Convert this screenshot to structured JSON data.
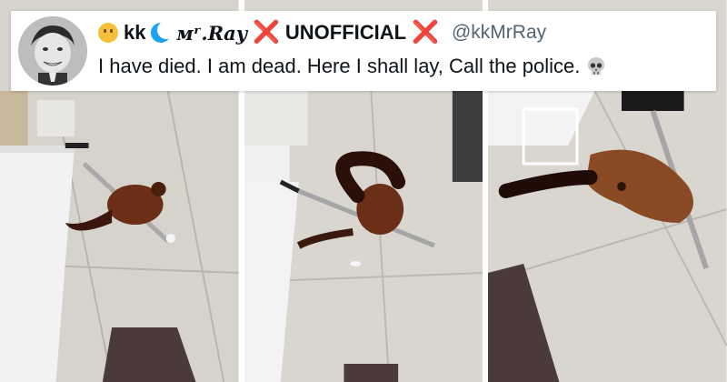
{
  "tweet": {
    "display_name_prefix": "kk",
    "display_name_mr": "ᴍʳ.𝑹𝒂𝒚",
    "display_name_suffix": "UNOFFICIAL",
    "x_mark": "❌",
    "handle": "@kkMrRay",
    "text": "I have died. I am dead. Here I shall lay, Call the police.",
    "icons": [
      "thinking-face-emoji",
      "moon-icon",
      "cross-mark-emoji",
      "skull-emoji"
    ]
  },
  "frames": [
    {
      "subject": "squirrel-clinging-to-mop"
    },
    {
      "subject": "squirrel-curled-on-mop"
    },
    {
      "subject": "squirrel-spread-on-mop"
    }
  ],
  "colors": {
    "floor": "#d9d6d0",
    "squirrel": "#6b2e16",
    "handle_blue": "#1da1f2",
    "x_red": "#e0245e"
  }
}
